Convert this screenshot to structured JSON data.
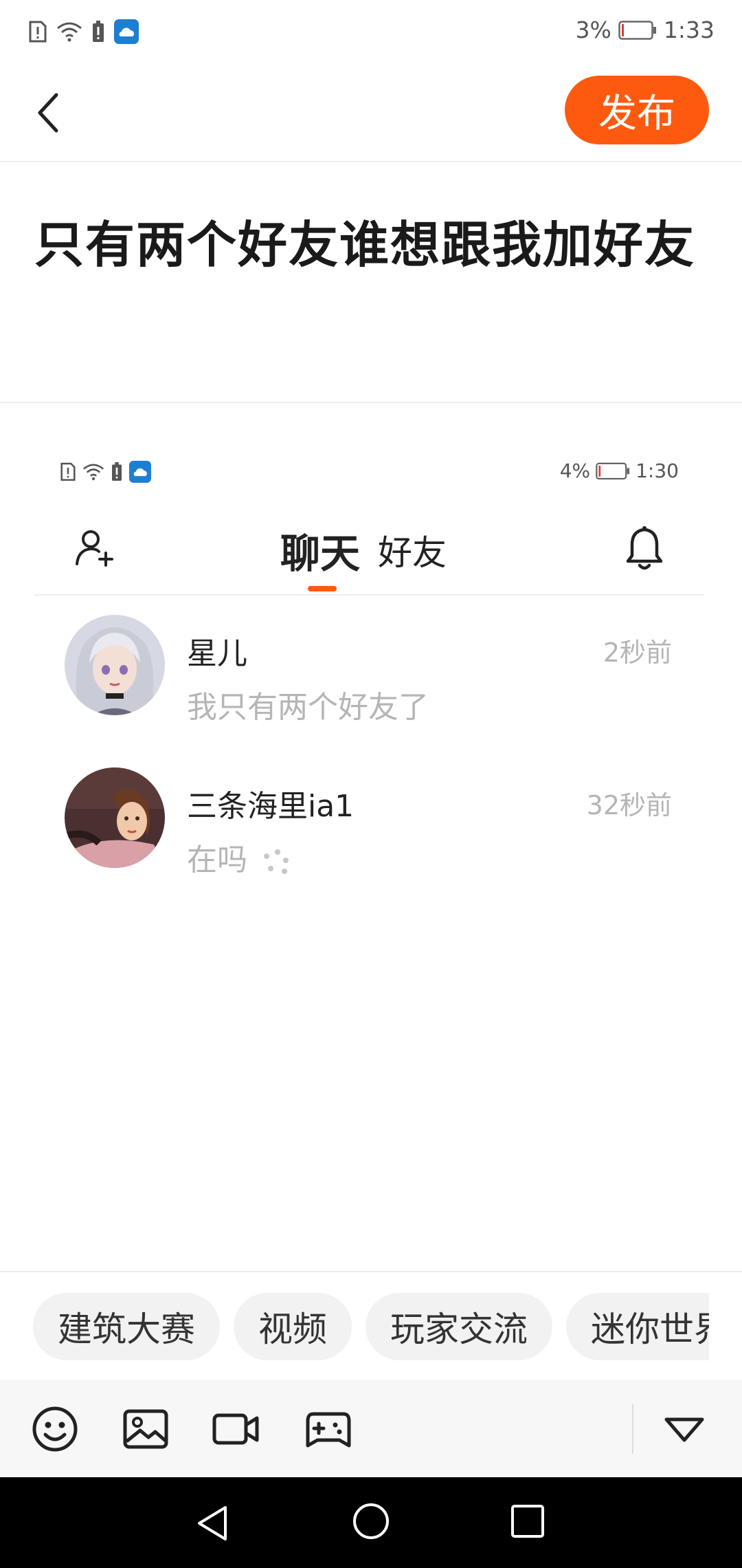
{
  "status_bar": {
    "battery": "3%",
    "time": "1:33"
  },
  "header": {
    "publish_label": "发布"
  },
  "post": {
    "title": "只有两个好友谁想跟我加好友"
  },
  "embedded": {
    "status_bar": {
      "battery": "4%",
      "time": "1:30"
    },
    "tabs": {
      "active": "聊天",
      "other": "好友"
    },
    "chats": [
      {
        "name": "星儿",
        "message": "我只有两个好友了",
        "time": "2秒前"
      },
      {
        "name": "三条海里ia1",
        "message": "在吗",
        "time": "32秒前"
      }
    ]
  },
  "tags": [
    "建筑大赛",
    "视频",
    "玩家交流",
    "迷你世界"
  ],
  "toolbar": {
    "icons": [
      "emoji-icon",
      "image-icon",
      "video-icon",
      "game-icon",
      "collapse-icon"
    ]
  },
  "colors": {
    "accent": "#fe5a0f",
    "secondary_text": "#b5b5b5"
  }
}
